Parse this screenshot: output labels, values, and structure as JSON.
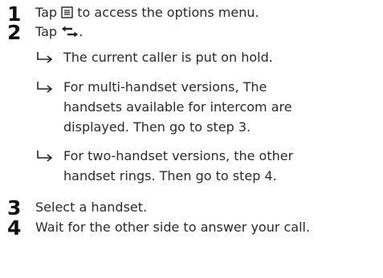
{
  "steps": [
    {
      "number": "1",
      "text_before": "Tap",
      "icon": "menu-icon",
      "text_after": "to access the options menu."
    },
    {
      "number": "2",
      "text_before": "Tap",
      "icon": "intercom-icon",
      "text_after": ".",
      "results": [
        {
          "lines": [
            "The current caller is put on hold."
          ]
        },
        {
          "lines": [
            "For multi-handset versions, The",
            "handsets available for intercom are",
            "displayed. Then go to step 3."
          ]
        },
        {
          "lines": [
            "For two-handset versions, the other",
            "handset rings. Then go to step 4."
          ]
        }
      ],
      "result_icon": "result-arrow-icon"
    },
    {
      "number": "3",
      "text": "Select a handset."
    },
    {
      "number": "4",
      "text": "Wait for the other side to answer your call."
    }
  ]
}
